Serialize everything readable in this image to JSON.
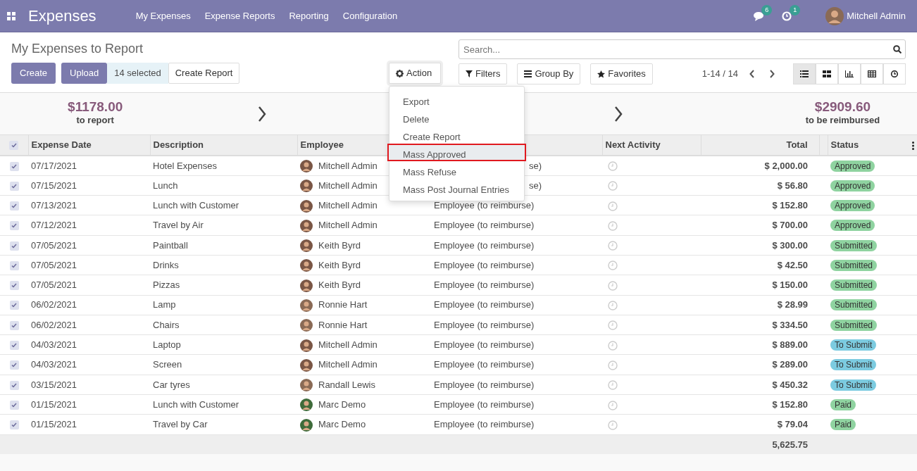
{
  "navbar": {
    "app": "Expenses",
    "menu": [
      "My Expenses",
      "Expense Reports",
      "Reporting",
      "Configuration"
    ],
    "messages_count": "6",
    "activities_count": "1",
    "user": "Mitchell Admin"
  },
  "control_panel": {
    "title": "My Expenses to Report",
    "buttons": [
      "Create",
      "Upload"
    ],
    "selected_count": "14 selected",
    "create_report": "Create Report",
    "action": "Action",
    "search": {
      "placeholder": "Search..."
    },
    "filters": "Filters",
    "group_by": "Group By",
    "favorites": "Favorites",
    "pager": "1-14 / 14",
    "views": [
      {
        "kind": "list",
        "selected": true
      },
      {
        "kind": "kanban",
        "selected": false
      },
      {
        "kind": "graph",
        "selected": false
      },
      {
        "kind": "pivot",
        "selected": false
      },
      {
        "kind": "activity",
        "selected": false
      }
    ]
  },
  "action_menu": [
    {
      "label": "Export",
      "highlighted": false
    },
    {
      "label": "Delete",
      "highlighted": false
    },
    {
      "label": "Create Report",
      "highlighted": false
    },
    {
      "label": "Mass Approved",
      "highlighted": true
    },
    {
      "label": "Mass Refuse",
      "highlighted": false
    },
    {
      "label": "Mass Post Journal Entries",
      "highlighted": false
    }
  ],
  "summary": [
    {
      "amount": "$1178.00",
      "label": "to report"
    },
    {
      "amount": "$2909.60",
      "label": "to be reimbursed"
    }
  ],
  "table": {
    "all_selected": true,
    "columns": [
      "Expense Date",
      "Description",
      "Employee",
      "Next Activity",
      "Total",
      "Status"
    ],
    "rows": [
      {
        "selected": true,
        "date": "07/17/2021",
        "description": "Hotel Expenses",
        "employee": "Mitchell Admin",
        "paid_by": "se)",
        "covered": true,
        "total": "$ 2,000.00",
        "status": "Approved",
        "color": "#8fd3a0"
      },
      {
        "selected": true,
        "date": "07/15/2021",
        "description": "Lunch",
        "employee": "Mitchell Admin",
        "paid_by": "se)",
        "covered": true,
        "total": "$ 56.80",
        "status": "Approved",
        "color": "#8fd3a0"
      },
      {
        "selected": true,
        "date": "07/13/2021",
        "description": "Lunch with Customer",
        "employee": "Mitchell Admin",
        "paid_by": "Employee (to reimburse)",
        "covered": false,
        "total": "$ 152.80",
        "status": "Approved",
        "color": "#8fd3a0"
      },
      {
        "selected": true,
        "date": "07/12/2021",
        "description": "Travel by Air",
        "employee": "Mitchell Admin",
        "paid_by": "Employee (to reimburse)",
        "covered": false,
        "total": "$ 700.00",
        "status": "Approved",
        "color": "#8fd3a0"
      },
      {
        "selected": true,
        "date": "07/05/2021",
        "description": "Paintball",
        "employee": "Keith Byrd",
        "paid_by": "Employee (to reimburse)",
        "covered": false,
        "total": "$ 300.00",
        "status": "Submitted",
        "color": "#8fd3a0"
      },
      {
        "selected": true,
        "date": "07/05/2021",
        "description": "Drinks",
        "employee": "Keith Byrd",
        "paid_by": "Employee (to reimburse)",
        "covered": false,
        "total": "$ 42.50",
        "status": "Submitted",
        "color": "#8fd3a0"
      },
      {
        "selected": true,
        "date": "07/05/2021",
        "description": "Pizzas",
        "employee": "Keith Byrd",
        "paid_by": "Employee (to reimburse)",
        "covered": false,
        "total": "$ 150.00",
        "status": "Submitted",
        "color": "#8fd3a0"
      },
      {
        "selected": true,
        "date": "06/02/2021",
        "description": "Lamp",
        "employee": "Ronnie Hart",
        "paid_by": "Employee (to reimburse)",
        "covered": false,
        "total": "$ 28.99",
        "status": "Submitted",
        "color": "#8fd3a0"
      },
      {
        "selected": true,
        "date": "06/02/2021",
        "description": "Chairs",
        "employee": "Ronnie Hart",
        "paid_by": "Employee (to reimburse)",
        "covered": false,
        "total": "$ 334.50",
        "status": "Submitted",
        "color": "#8fd3a0"
      },
      {
        "selected": true,
        "date": "04/03/2021",
        "description": "Laptop",
        "employee": "Mitchell Admin",
        "paid_by": "Employee (to reimburse)",
        "covered": false,
        "total": "$ 889.00",
        "status": "To Submit",
        "color": "#7ccbe0"
      },
      {
        "selected": true,
        "date": "04/03/2021",
        "description": "Screen",
        "employee": "Mitchell Admin",
        "paid_by": "Employee (to reimburse)",
        "covered": false,
        "total": "$ 289.00",
        "status": "To Submit",
        "color": "#7ccbe0"
      },
      {
        "selected": true,
        "date": "03/15/2021",
        "description": "Car tyres",
        "employee": "Randall Lewis",
        "paid_by": "Employee (to reimburse)",
        "covered": false,
        "total": "$ 450.32",
        "status": "To Submit",
        "color": "#7ccbe0"
      },
      {
        "selected": true,
        "date": "01/15/2021",
        "description": "Lunch with Customer",
        "employee": "Marc Demo",
        "paid_by": "Employee (to reimburse)",
        "covered": false,
        "total": "$ 152.80",
        "status": "Paid",
        "color": "#8fd3a0"
      },
      {
        "selected": true,
        "date": "01/15/2021",
        "description": "Travel by Car",
        "employee": "Marc Demo",
        "paid_by": "Employee (to reimburse)",
        "covered": false,
        "total": "$ 79.04",
        "status": "Paid",
        "color": "#8fd3a0"
      }
    ],
    "grand_total": "5,625.75"
  }
}
